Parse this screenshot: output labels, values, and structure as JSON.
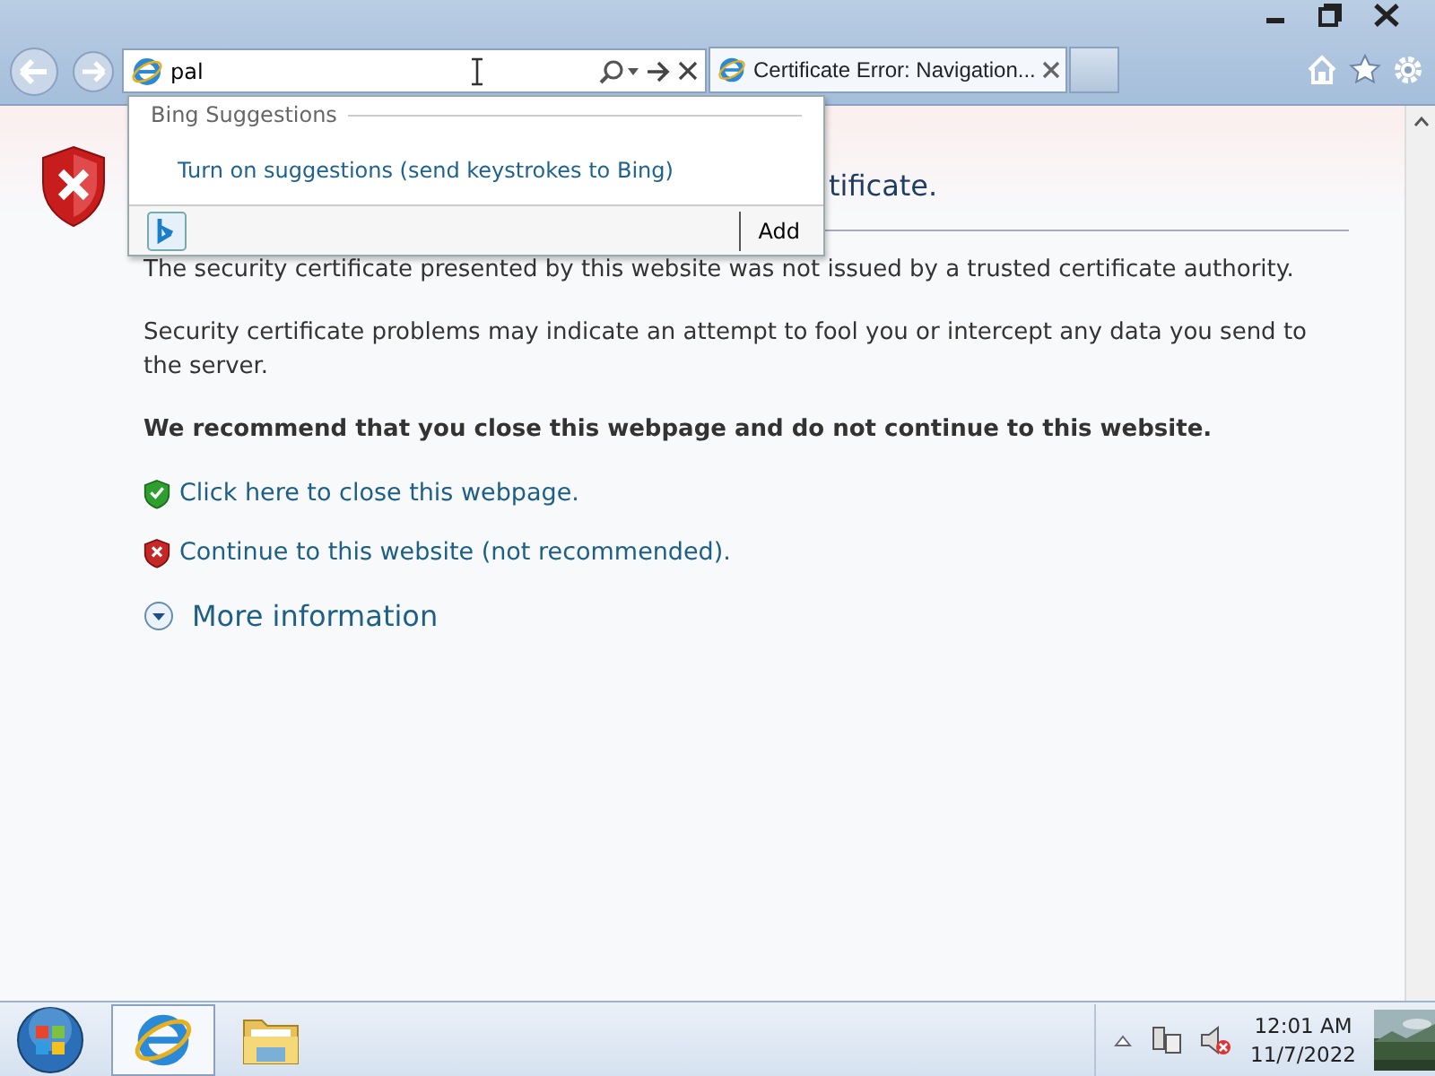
{
  "address_bar": {
    "value": "pal"
  },
  "tabs": [
    {
      "label": "Certificate Error: Navigation...",
      "selected": true
    }
  ],
  "suggestions": {
    "heading": "Bing Suggestions",
    "link": "Turn on suggestions (send keystrokes to Bing)",
    "add_button": "Add"
  },
  "page": {
    "heading": "tificate.",
    "paragraphs": [
      "The security certificate presented by this website was not issued by a trusted certificate authority.",
      "Security certificate problems may indicate an attempt to fool you or intercept any data you send to the server."
    ],
    "recommendation": "We recommend that you close this webpage and do not continue to this website.",
    "actions": [
      {
        "kind": "safe",
        "label": "Click here to close this webpage."
      },
      {
        "kind": "unsafe",
        "label": "Continue to this website (not recommended)."
      }
    ],
    "more_info": "More information"
  },
  "taskbar": {
    "items": [
      {
        "kind": "browser",
        "selected": true
      },
      {
        "kind": "folder",
        "selected": false
      }
    ],
    "time": "12:01 AM",
    "date": "11/7/2022"
  }
}
